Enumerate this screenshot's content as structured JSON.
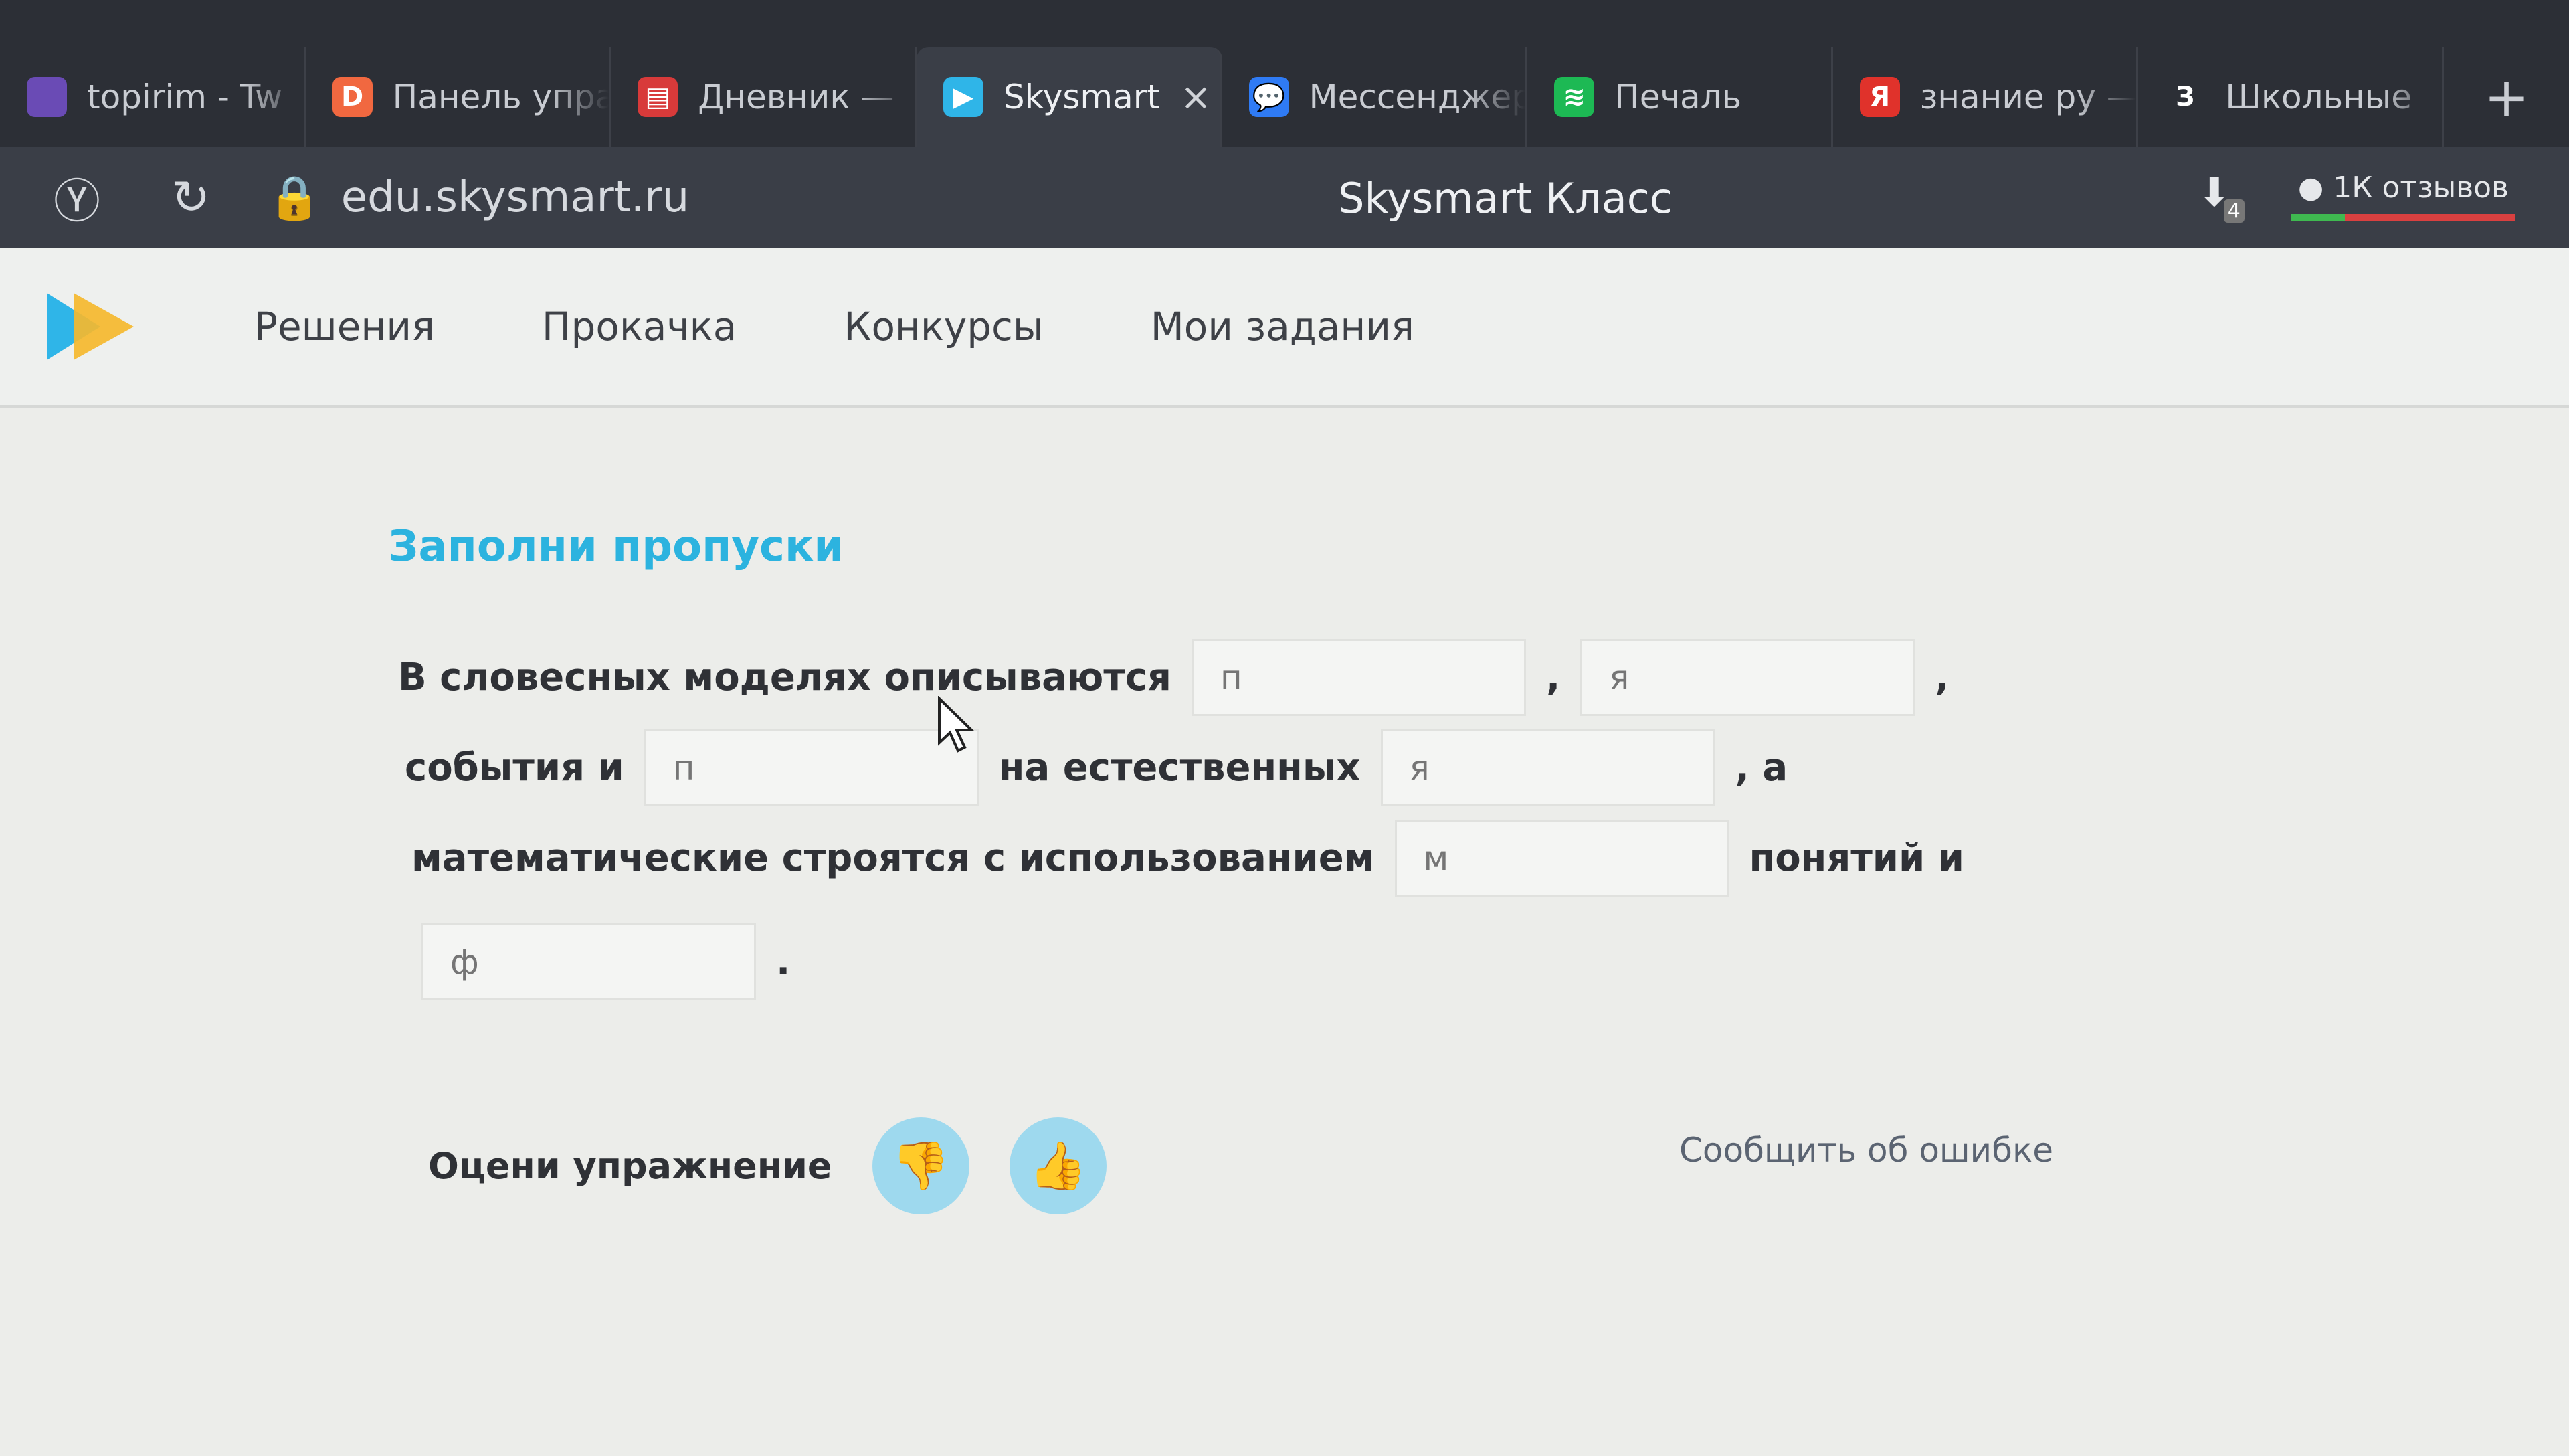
{
  "browser": {
    "tabs": [
      {
        "label": "topirim - Tw",
        "icon": "twitch-icon",
        "color": "#6a4bb5",
        "glyph": "",
        "active": false
      },
      {
        "label": "Панель упра",
        "icon": "patreon-icon",
        "color": "#f16840",
        "glyph": "D",
        "active": false
      },
      {
        "label": "Дневник —",
        "icon": "diary-icon",
        "color": "#d83a3a",
        "glyph": "▤",
        "active": false
      },
      {
        "label": "Skysmart",
        "icon": "skysmart-icon",
        "color": "#2fb5e8",
        "glyph": "▶",
        "active": true
      },
      {
        "label": "Мессенджер",
        "icon": "messenger-icon",
        "color": "#2f7bf5",
        "glyph": "💬",
        "active": false
      },
      {
        "label": "Печаль",
        "icon": "spotify-icon",
        "color": "#1db954",
        "glyph": "≋",
        "active": false
      },
      {
        "label": "знание ру —",
        "icon": "yandex-icon",
        "color": "#e0322b",
        "glyph": "Я",
        "active": false
      },
      {
        "label": "Школьные",
        "icon": "school-icon",
        "color": "#2c2f36",
        "glyph": "З",
        "active": false
      }
    ],
    "address": "edu.skysmart.ru",
    "page_title": "Skysmart Класс",
    "reviews": "1К отзывов",
    "downloads_badge": "4"
  },
  "site": {
    "menu": [
      "Решения",
      "Прокачка",
      "Конкурсы",
      "Мои задания"
    ]
  },
  "exercise": {
    "title": "Заполни пропуски",
    "line1_text": "В словесных моделях описываются",
    "gap1": "п",
    "comma1": ",",
    "gap2": "я",
    "comma2": ",",
    "line2_text_a": "события и",
    "gap3": "п",
    "line2_text_b": "на естественных",
    "gap4": "я",
    "line2_text_c": ", а",
    "line3_text_a": "математические строятся с использованием",
    "gap5": "м",
    "line3_text_b": "понятий и",
    "gap6": "ф",
    "period": "."
  },
  "rating": {
    "label": "Оцени упражнение",
    "report": "Сообщить об ошибке"
  }
}
